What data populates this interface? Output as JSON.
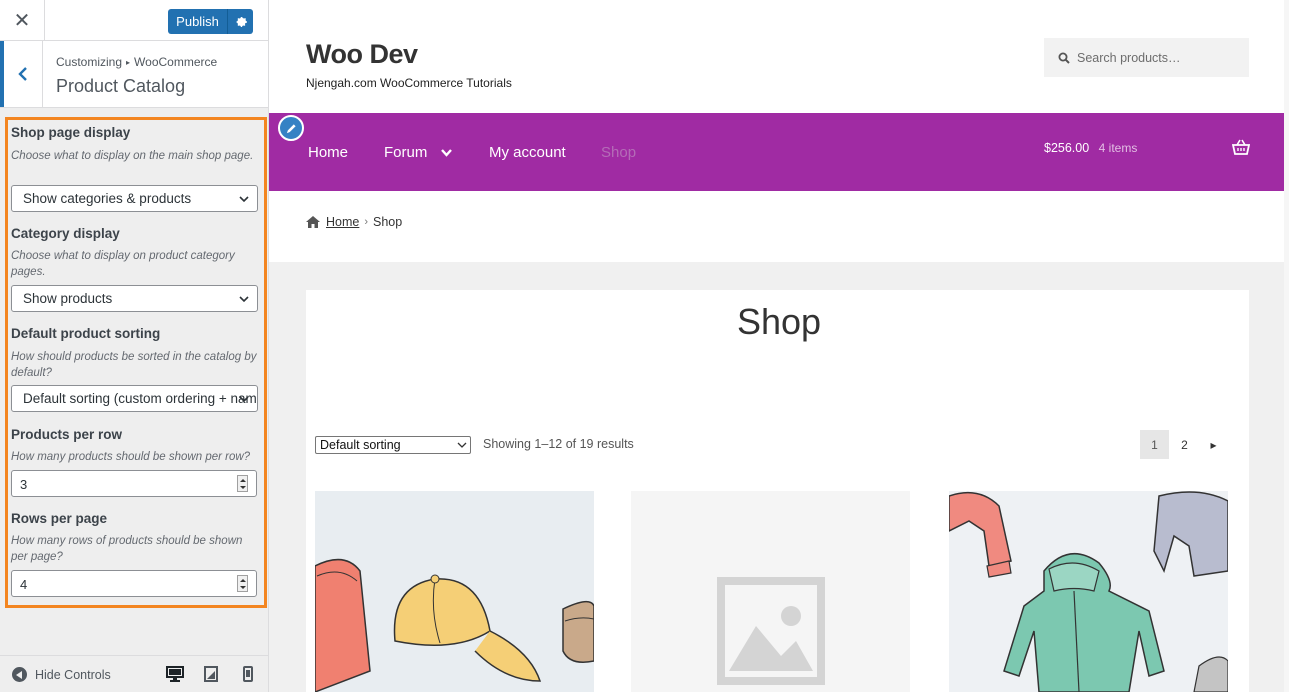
{
  "customizer": {
    "close_glyph": "✕",
    "publish_label": "Publish",
    "breadcrumb_root": "Customizing",
    "breadcrumb_sep": "▸",
    "breadcrumb_panel": "WooCommerce",
    "section_title": "Product Catalog",
    "controls": {
      "shop_display": {
        "title": "Shop page display",
        "description": "Choose what to display on the main shop page.",
        "value": "Show categories & products"
      },
      "category_display": {
        "title": "Category display",
        "description": "Choose what to display on product category pages.",
        "value": "Show products"
      },
      "default_sorting": {
        "title": "Default product sorting",
        "description": "How should products be sorted in the catalog by default?",
        "value": "Default sorting (custom ordering + name)"
      },
      "products_per_row": {
        "title": "Products per row",
        "description": "How many products should be shown per row?",
        "value": "3"
      },
      "rows_per_page": {
        "title": "Rows per page",
        "description": "How many rows of products should be shown per page?",
        "value": "4"
      }
    },
    "footer": {
      "hide_controls_label": "Hide Controls"
    }
  },
  "site": {
    "title": "Woo Dev",
    "tagline": "Njengah.com WooCommerce Tutorials",
    "search_placeholder": "Search products…",
    "nav": [
      {
        "label": "Home"
      },
      {
        "label": "Forum"
      },
      {
        "label": "My account"
      },
      {
        "label": "Shop"
      }
    ],
    "cart": {
      "total": "$256.00",
      "count": "4 items"
    },
    "breadcrumb": {
      "home": "Home",
      "sep": "›",
      "current": "Shop"
    },
    "page_title": "Shop",
    "sorting_value": "Default sorting",
    "result_count": "Showing 1–12 of 19 results",
    "pagination": [
      "1",
      "2"
    ],
    "pagination_next": "▸"
  },
  "colors": {
    "accent": "#2271b1",
    "highlight_border": "#f38520",
    "nav_background": "#a02ba3"
  }
}
